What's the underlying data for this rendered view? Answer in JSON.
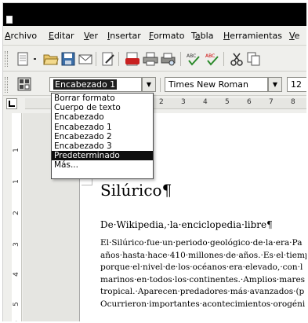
{
  "menubar": {
    "items": [
      {
        "label": "Archivo",
        "accel": "A"
      },
      {
        "label": "Editar",
        "accel": "E"
      },
      {
        "label": "Ver",
        "accel": "V"
      },
      {
        "label": "Insertar",
        "accel": "I"
      },
      {
        "label": "Formato",
        "accel": "F"
      },
      {
        "label": "Tabla",
        "accel": "a"
      },
      {
        "label": "Herramientas",
        "accel": "H"
      },
      {
        "label": "Ve",
        "accel": "V"
      }
    ]
  },
  "toolbar": {
    "icons": [
      "new-document-icon",
      "open-folder-icon",
      "save-icon",
      "email-icon",
      "edit-file-icon",
      "export-pdf-icon",
      "print-icon",
      "print-preview-icon",
      "spellcheck-icon",
      "autospellcheck-icon",
      "cut-icon",
      "copy-icon"
    ]
  },
  "formatting": {
    "style_value": "Encabezado 1",
    "font_value": "Times New Roman",
    "size_value": "12"
  },
  "style_dropdown": {
    "items": [
      "Borrar formato",
      "Cuerpo de texto",
      "Encabezado",
      "Encabezado 1",
      "Encabezado 2",
      "Encabezado 3",
      "Predeterminado",
      "Más..."
    ],
    "selected_index": 6
  },
  "ruler": {
    "h_numbers": [
      "2",
      "3",
      "4",
      "5",
      "6",
      "7",
      "8"
    ],
    "v_numbers": [
      "1",
      "1",
      "2",
      "3",
      "4",
      "5",
      "6"
    ]
  },
  "document": {
    "heading1": "Silúrico",
    "heading2": "De·Wikipedia,·la·enciclopedia·libre",
    "paragraph_lines": [
      "El·Silúrico·fue·un·periodo·geológico·de·la·era·Pa",
      "años·hasta·hace·410·millones·de·años.·Es·el·tiemp",
      "porque·el·nivel·de·los·océanos·era·elevado,·con·l",
      "marinos·en·todos·los·continentes.·Amplios·mares",
      "tropical.·Aparecen·predadores·más·avanzados·(p",
      "Ocurrieron·importantes·acontecimientos·orogéni"
    ],
    "para_mark": "¶"
  },
  "colors": {
    "titlebar": "#000000",
    "chrome": "#efefec",
    "selection": "#0f0f0f"
  }
}
